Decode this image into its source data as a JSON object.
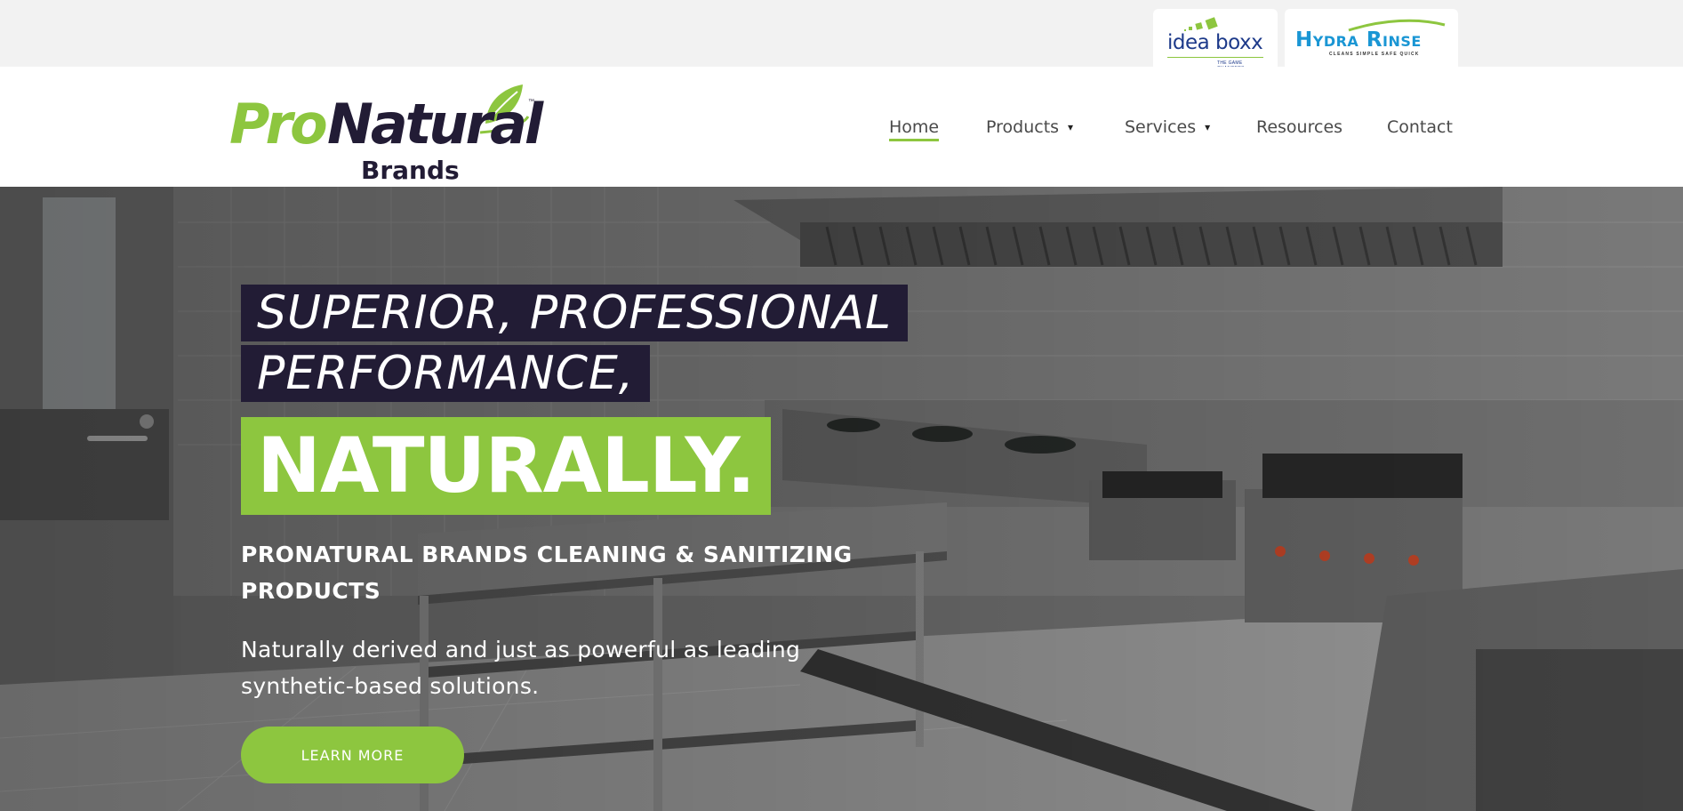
{
  "topbar": {
    "partners": [
      {
        "name": "idea boxx",
        "tagline": "THE GAME CHANGERS"
      },
      {
        "name": "Hydra Rinse",
        "tagline": "CLEANS SIMPLE SAFE QUICK"
      }
    ]
  },
  "header": {
    "logo": {
      "part1": "Pro",
      "part2": "Natural",
      "part3": "Brands",
      "tm": "™"
    },
    "nav": [
      {
        "label": "Home",
        "active": true,
        "has_dropdown": false
      },
      {
        "label": "Products",
        "active": false,
        "has_dropdown": true
      },
      {
        "label": "Services",
        "active": false,
        "has_dropdown": true
      },
      {
        "label": "Resources",
        "active": false,
        "has_dropdown": false
      },
      {
        "label": "Contact",
        "active": false,
        "has_dropdown": false
      }
    ],
    "chevron": "▾"
  },
  "hero": {
    "headline_line1": "SUPERIOR, PROFESSIONAL",
    "headline_line2": "PERFORMANCE,",
    "headline_highlight": "NATURALLY.",
    "subheading": "PRONATURAL BRANDS CLEANING & SANITIZING PRODUCTS",
    "description": "Naturally derived and just as powerful as leading synthetic-based solutions.",
    "cta_label": "LEARN MORE"
  },
  "colors": {
    "brand_green": "#8dc63f",
    "brand_dark": "#221c35",
    "hydra_blue": "#1a96d4",
    "idea_blue": "#1d3a8a"
  }
}
